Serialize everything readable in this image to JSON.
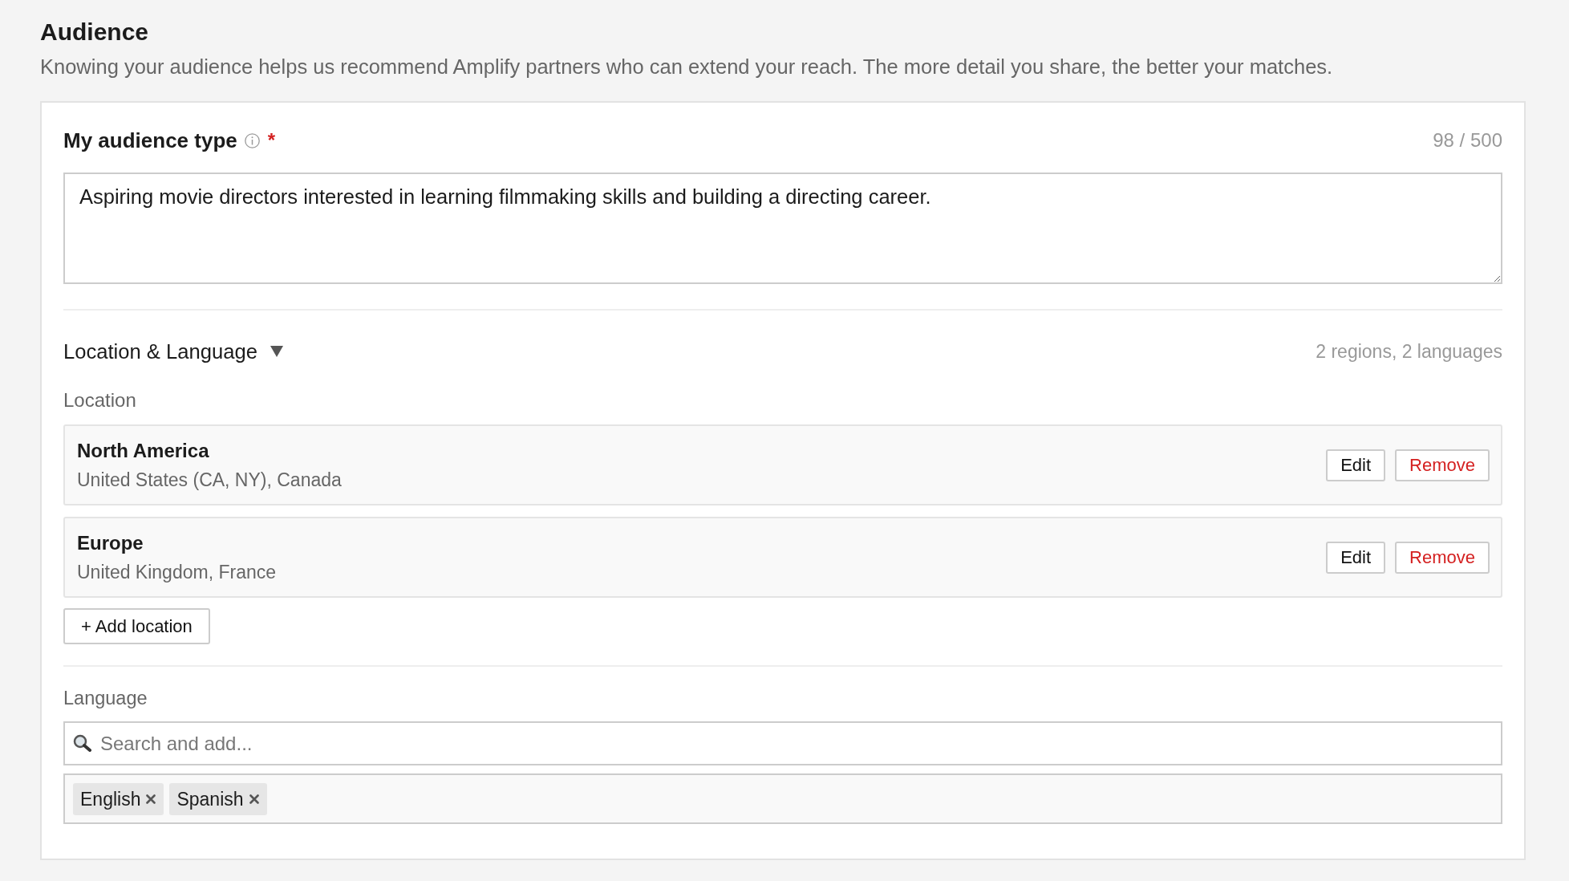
{
  "page": {
    "title": "Audience",
    "description": "Knowing your audience helps us recommend Amplify partners who can extend your reach. The more detail you share, the better your matches."
  },
  "audience_type": {
    "label": "My audience type",
    "required_mark": "*",
    "counter": "98 / 500",
    "value": "Aspiring movie directors interested in learning filmmaking skills and building a directing career."
  },
  "location_language": {
    "title": "Location & Language",
    "expanded": true,
    "summary": "2 regions, 2 languages",
    "location": {
      "label": "Location",
      "items": [
        {
          "name": "North America",
          "detail": "United States (CA, NY), Canada",
          "actions": [
            {
              "kind": "edit",
              "label": "Edit"
            },
            {
              "kind": "remove",
              "label": "Remove"
            }
          ]
        },
        {
          "name": "Europe",
          "detail": "United Kingdom, France",
          "actions": [
            {
              "kind": "edit",
              "label": "Edit"
            },
            {
              "kind": "remove",
              "label": "Remove"
            }
          ]
        }
      ],
      "add_button": "+ Add location"
    },
    "language": {
      "label": "Language",
      "search": {
        "placeholder": "Search and add..."
      },
      "tags": [
        {
          "label": "English"
        },
        {
          "label": "Spanish"
        }
      ]
    }
  }
}
